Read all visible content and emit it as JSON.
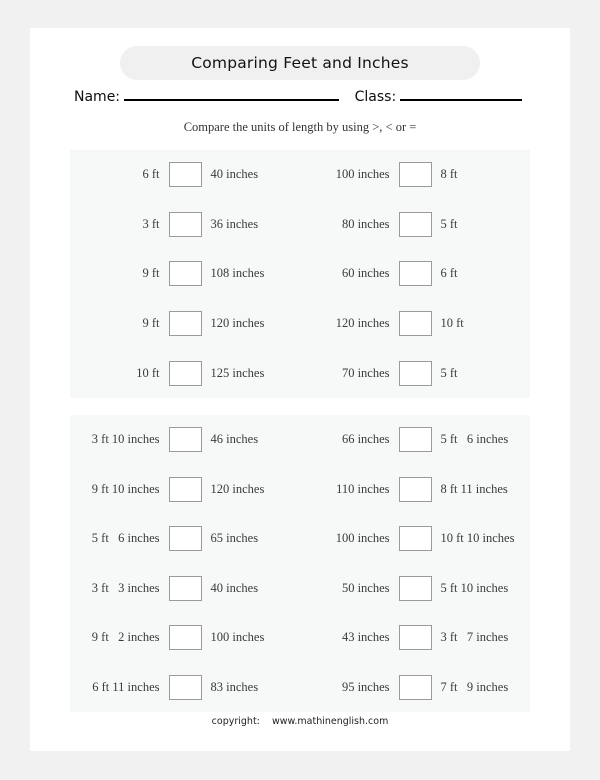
{
  "worksheet": {
    "title": "Comparing Feet and Inches",
    "name_label": "Name:",
    "class_label": "Class:",
    "instruction": "Compare the units of length by using >, < or =",
    "footer": "copyright:    www.mathinenglish.com"
  },
  "blocks": [
    {
      "id": "block-1",
      "rows": [
        {
          "left": {
            "a": "6 ft",
            "b": "40 inches"
          },
          "right": {
            "a": "100 inches",
            "b": "8 ft"
          }
        },
        {
          "left": {
            "a": "3 ft",
            "b": "36 inches"
          },
          "right": {
            "a": "80 inches",
            "b": "5 ft"
          }
        },
        {
          "left": {
            "a": "9 ft",
            "b": "108 inches"
          },
          "right": {
            "a": "60 inches",
            "b": "6 ft"
          }
        },
        {
          "left": {
            "a": "9 ft",
            "b": "120 inches"
          },
          "right": {
            "a": "120 inches",
            "b": "10 ft"
          }
        },
        {
          "left": {
            "a": "10 ft",
            "b": "125 inches"
          },
          "right": {
            "a": "70 inches",
            "b": "5 ft"
          }
        }
      ]
    },
    {
      "id": "block-2",
      "rows": [
        {
          "left": {
            "a": "3 ft 10 inches",
            "b": "46 inches"
          },
          "right": {
            "a": "66 inches",
            "b": "5 ft   6 inches"
          }
        },
        {
          "left": {
            "a": "9 ft 10 inches",
            "b": "120 inches"
          },
          "right": {
            "a": "110 inches",
            "b": "8 ft 11 inches"
          }
        },
        {
          "left": {
            "a": "5 ft   6 inches",
            "b": "65 inches"
          },
          "right": {
            "a": "100 inches",
            "b": "10 ft 10 inches"
          }
        },
        {
          "left": {
            "a": "3 ft   3 inches",
            "b": "40 inches"
          },
          "right": {
            "a": "50 inches",
            "b": "5 ft 10 inches"
          }
        },
        {
          "left": {
            "a": "9 ft   2 inches",
            "b": "100 inches"
          },
          "right": {
            "a": "43 inches",
            "b": "3 ft   7 inches"
          }
        },
        {
          "left": {
            "a": "6 ft 11 inches",
            "b": "83 inches"
          },
          "right": {
            "a": "95 inches",
            "b": "7 ft   9 inches"
          }
        }
      ]
    }
  ]
}
